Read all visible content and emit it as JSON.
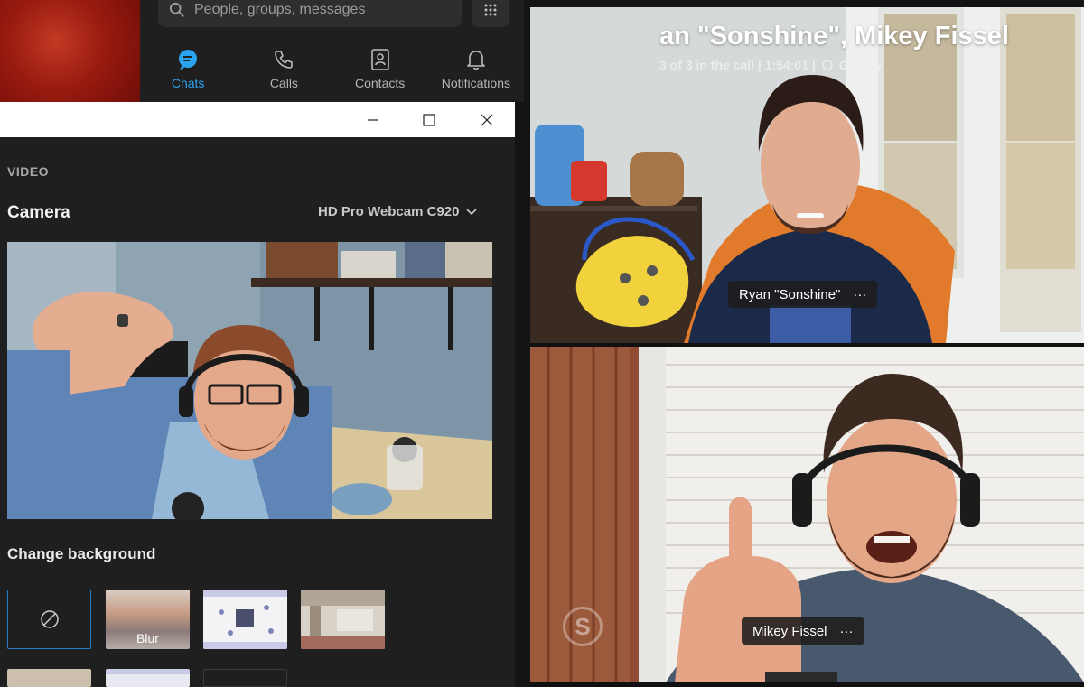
{
  "search": {
    "placeholder": "People, groups, messages"
  },
  "nav": {
    "tabs": [
      {
        "label": "Chats",
        "icon": "chat-icon",
        "active": true
      },
      {
        "label": "Calls",
        "icon": "phone-icon",
        "active": false
      },
      {
        "label": "Contacts",
        "icon": "contacts-icon",
        "active": false
      },
      {
        "label": "Notifications",
        "icon": "bell-icon",
        "active": false
      }
    ]
  },
  "settings": {
    "section": "VIDEO",
    "camera_label": "Camera",
    "camera_value": "HD Pro Webcam C920",
    "change_background_label": "Change background",
    "backgrounds": [
      {
        "label": "",
        "icon": "none-icon",
        "selected": true
      },
      {
        "label": "Blur",
        "selected": false
      },
      {
        "label": "",
        "selected": false
      },
      {
        "label": "",
        "selected": false
      }
    ]
  },
  "call": {
    "title": "an \"Sonshine\", Mikey Fissel",
    "participants_status": "3 of 3 in the call | 1:54:01 |",
    "view_mode": "Gallery",
    "participants": [
      {
        "name": "Ryan \"Sonshine\"",
        "more": "···"
      },
      {
        "name": "Mikey Fissel",
        "more": "···"
      }
    ]
  },
  "colors": {
    "accent": "#2aa3f0",
    "panel": "#1f1f1f",
    "selected_border": "#2b7fc8"
  }
}
